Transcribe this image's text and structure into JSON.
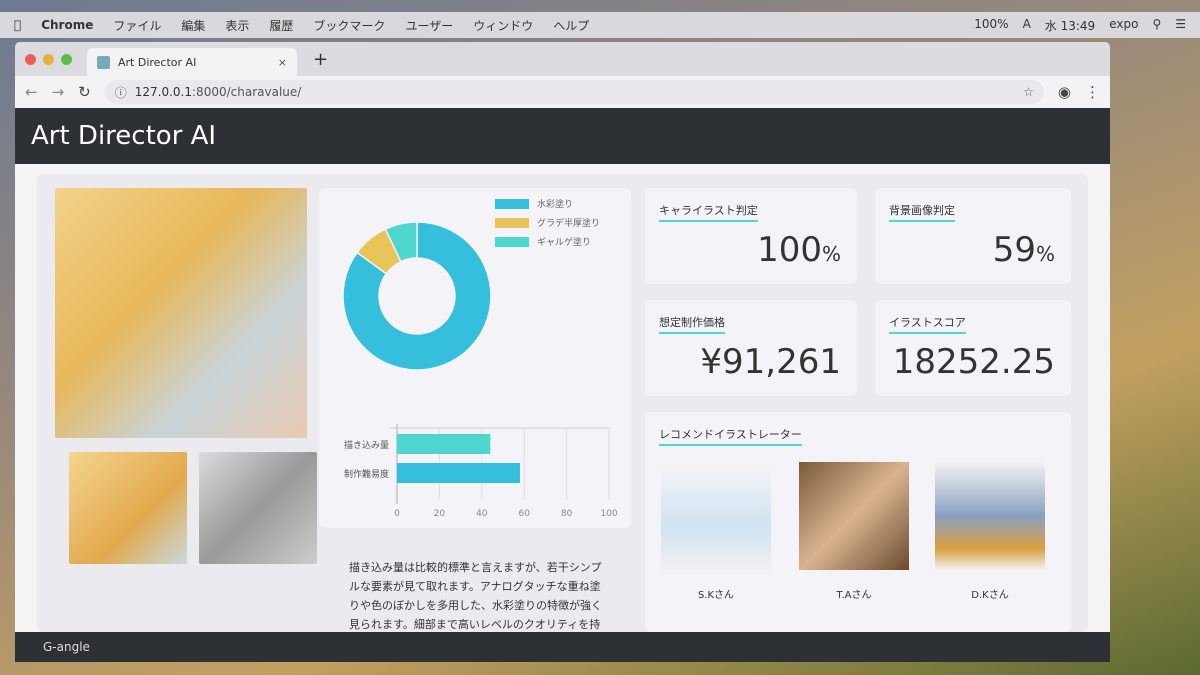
{
  "menubar": {
    "apple": "",
    "app": "Chrome",
    "items": [
      "ファイル",
      "編集",
      "表示",
      "履歴",
      "ブックマーク",
      "ユーザー",
      "ウィンドウ",
      "ヘルプ"
    ],
    "battery": "100%",
    "input": "A",
    "clock": "水 13:49",
    "user": "expo"
  },
  "browser": {
    "tab_title": "Art Director AI",
    "url_host": "127.0.0.1",
    "url_path": ":8000/charavalue/"
  },
  "app": {
    "title": "Art Director AI",
    "footer": "G-angle"
  },
  "stats": [
    {
      "label": "キャライラスト判定",
      "value": "100",
      "unit": "%"
    },
    {
      "label": "背景画像判定",
      "value": "59",
      "unit": "%"
    },
    {
      "label": "想定制作価格",
      "value": "¥91,261",
      "unit": ""
    },
    {
      "label": "イラストスコア",
      "value": "18252.25",
      "unit": ""
    }
  ],
  "recommend": {
    "title": "レコメンドイラストレーター",
    "items": [
      "S.Kさん",
      "T.Aさん",
      "D.Kさん"
    ]
  },
  "description": [
    "描き込み量は比較的標準と言えますが、若干シンプ",
    "ルな要素が見て取れます。アナログタッチな重ね塗",
    "りや色のぼかしを多用した、水彩塗りの特徴が強く",
    "見られます。細部まで高いレベルのクオリティを持"
  ],
  "chart_data": [
    {
      "type": "pie",
      "donut": true,
      "labels": [
        "水彩塗り",
        "グラデ半厚塗り",
        "ギャルゲ塗り"
      ],
      "values": [
        85,
        8,
        7
      ],
      "colors": [
        "#36bfdc",
        "#e8c45a",
        "#4fd6cf"
      ],
      "legend": "top-right"
    },
    {
      "type": "bar",
      "orientation": "horizontal",
      "categories": [
        "描き込み量",
        "制作難易度"
      ],
      "values": [
        44,
        58
      ],
      "colors": [
        "#4fd6cf",
        "#36bfdc"
      ],
      "xlim": [
        0,
        100
      ],
      "xticks": [
        0,
        20,
        40,
        60,
        80,
        100
      ],
      "grid": true
    }
  ]
}
